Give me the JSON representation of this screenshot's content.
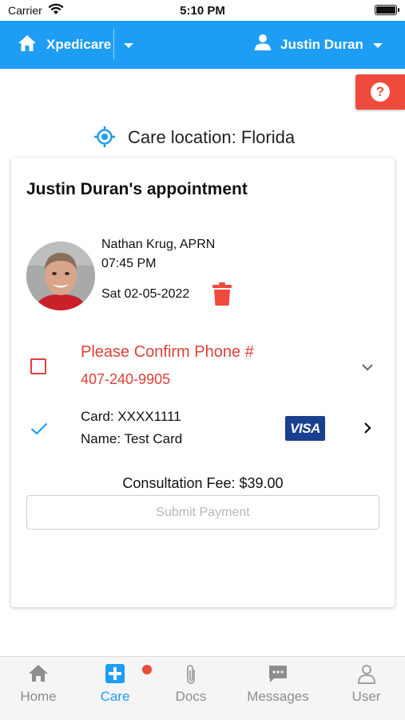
{
  "status_bar": {
    "carrier": "Carrier",
    "time": "5:10 PM"
  },
  "header": {
    "app_name": "Xpedicare",
    "user_name": "Justin Duran"
  },
  "care_location": {
    "text": "Care location: Florida"
  },
  "appointment": {
    "title": "Justin Duran's appointment",
    "provider": "Nathan Krug, APRN",
    "time": "07:45 PM",
    "date": "Sat 02-05-2022"
  },
  "phone": {
    "prompt": "Please Confirm Phone #",
    "number": "407-240-9905",
    "confirmed": false
  },
  "payment": {
    "card_number": "Card: XXXX1111",
    "card_name": "Name: Test Card",
    "card_brand": "VISA",
    "selected": true
  },
  "fee": "Consultation Fee: $39.00",
  "submit_label": "Submit Payment",
  "tabs": [
    {
      "label": "Home",
      "icon": "home-icon",
      "active": false
    },
    {
      "label": "Care",
      "icon": "medical-plus-icon",
      "active": true,
      "badge": true
    },
    {
      "label": "Docs",
      "icon": "paperclip-icon",
      "active": false
    },
    {
      "label": "Messages",
      "icon": "chat-icon",
      "active": false
    },
    {
      "label": "User",
      "icon": "user-icon",
      "active": false
    }
  ],
  "colors": {
    "primary": "#1e9df5",
    "danger": "#f04a3c",
    "visa": "#1a3f8f"
  }
}
